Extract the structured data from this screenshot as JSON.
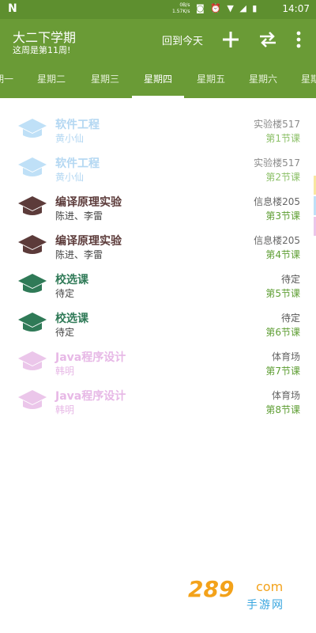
{
  "status_bar": {
    "net_speed_line1": "0B/s",
    "net_speed_line2": "1.57K/s",
    "time": "14:07"
  },
  "header": {
    "title": "大二下学期",
    "subtitle": "这周是第11周!",
    "today_label": "回到今天"
  },
  "tabs": [
    {
      "label": "星期一"
    },
    {
      "label": "星期二"
    },
    {
      "label": "星期三"
    },
    {
      "label": "星期四"
    },
    {
      "label": "星期五"
    },
    {
      "label": "星期六"
    },
    {
      "label": "星期日"
    }
  ],
  "courses": [
    {
      "name": "软件工程",
      "teacher": "黄小仙",
      "room": "实验楼517",
      "period": "第1节课"
    },
    {
      "name": "软件工程",
      "teacher": "黄小仙",
      "room": "实验楼517",
      "period": "第2节课"
    },
    {
      "name": "编译原理实验",
      "teacher": "陈进、李雷",
      "room": "信息楼205",
      "period": "第3节课"
    },
    {
      "name": "编译原理实验",
      "teacher": "陈进、李雷",
      "room": "信息楼205",
      "period": "第4节课"
    },
    {
      "name": "校选课",
      "teacher": "待定",
      "room": "待定",
      "period": "第5节课"
    },
    {
      "name": "校选课",
      "teacher": "待定",
      "room": "待定",
      "period": "第6节课"
    },
    {
      "name": "Java程序设计",
      "teacher": "韩明",
      "room": "体育场",
      "period": "第7节课"
    },
    {
      "name": "Java程序设计",
      "teacher": "韩明",
      "room": "体育场",
      "period": "第8节课"
    }
  ],
  "watermark": {
    "number": "289",
    "suffix": "com",
    "site": "手游网"
  },
  "colors": {
    "header_green": "#6a9b36",
    "period_green": "#5e9e33",
    "cap_light_blue": "#bfe0f7",
    "cap_brown": "#5c3b3a",
    "cap_green": "#2f7a57",
    "cap_pink": "#ebc6ea"
  }
}
